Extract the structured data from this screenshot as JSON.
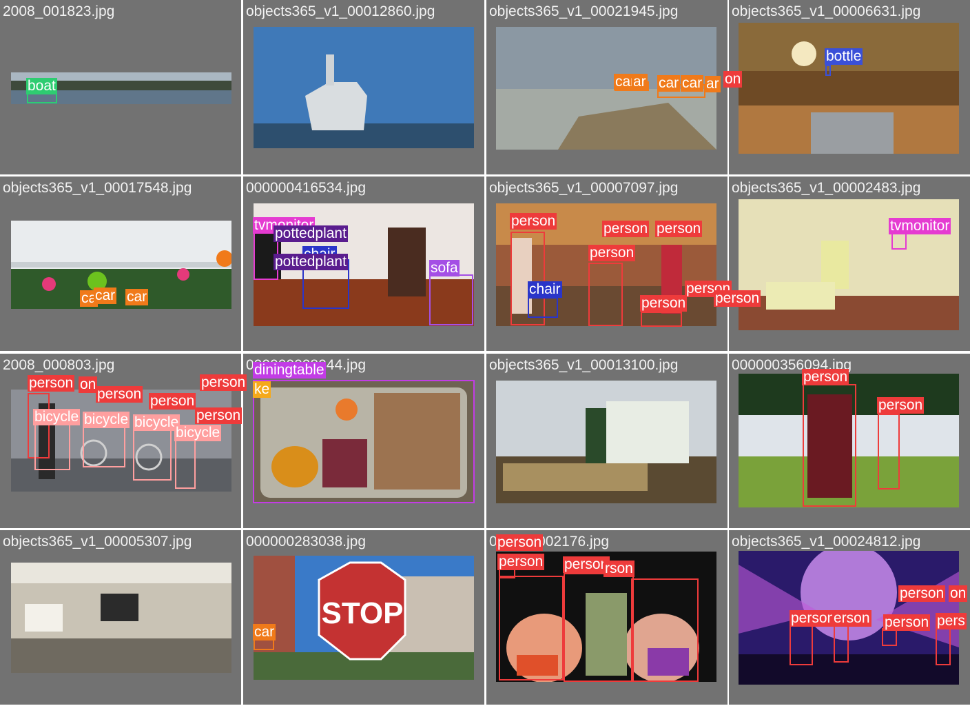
{
  "colors": {
    "cell_bg": "#727272",
    "title_text": "#f2f2f2",
    "boat": "#2ecc71",
    "person": "#ee3b3b",
    "car": "#f07a1a",
    "bottle": "#3a50d8",
    "tvmonitor": "#e53bd1",
    "pottedplant": "#5a1d8e",
    "chair": "#2a35c9",
    "sofa": "#a44fe5",
    "bicycle": "#ff9f9f",
    "diningtable": "#c23ce6",
    "cake": "#f5a91b"
  },
  "cells": [
    {
      "title": "2008_001823.jpg",
      "labels": [
        "boat"
      ]
    },
    {
      "title": "objects365_v1_00012860.jpg",
      "labels": []
    },
    {
      "title": "objects365_v1_00021945.jpg",
      "labels": [
        "car",
        "ar",
        "car",
        "car",
        "ar",
        "on"
      ]
    },
    {
      "title": "objects365_v1_00006631.jpg",
      "labels": [
        "bottle"
      ]
    },
    {
      "title": "objects365_v1_00017548.jpg",
      "labels": [
        "ca",
        "car",
        "car"
      ]
    },
    {
      "title": "000000416534.jpg",
      "labels": [
        "tvmonitor",
        "pottedplant",
        "chair",
        "pottedplant",
        "sofa"
      ]
    },
    {
      "title": "objects365_v1_00007097.jpg",
      "labels": [
        "person",
        "person",
        "person",
        "person",
        "chair",
        "person",
        "person",
        "person"
      ]
    },
    {
      "title": "objects365_v1_00002483.jpg",
      "labels": [
        "tvmonitor"
      ]
    },
    {
      "title": "2008_000803.jpg",
      "labels": [
        "person",
        "on",
        "person",
        "person",
        "person",
        "bicycle",
        "bicycle",
        "bicycle",
        "person",
        "bicycle"
      ]
    },
    {
      "title": "000000008044.jpg",
      "labels": [
        "diningtable",
        "ke"
      ]
    },
    {
      "title": "objects365_v1_00013100.jpg",
      "labels": []
    },
    {
      "title": "000000356094.jpg",
      "labels": [
        "person",
        "person"
      ]
    },
    {
      "title": "objects365_v1_00005307.jpg",
      "labels": []
    },
    {
      "title": "000000283038.jpg",
      "labels": [
        "car",
        "STOP"
      ]
    },
    {
      "title": "000000002176.jpg",
      "labels": [
        "person",
        "person",
        "person",
        "rson"
      ]
    },
    {
      "title": "objects365_v1_00024812.jpg",
      "labels": [
        "person",
        "erson",
        "person",
        "on",
        "person",
        "pers"
      ]
    }
  ]
}
